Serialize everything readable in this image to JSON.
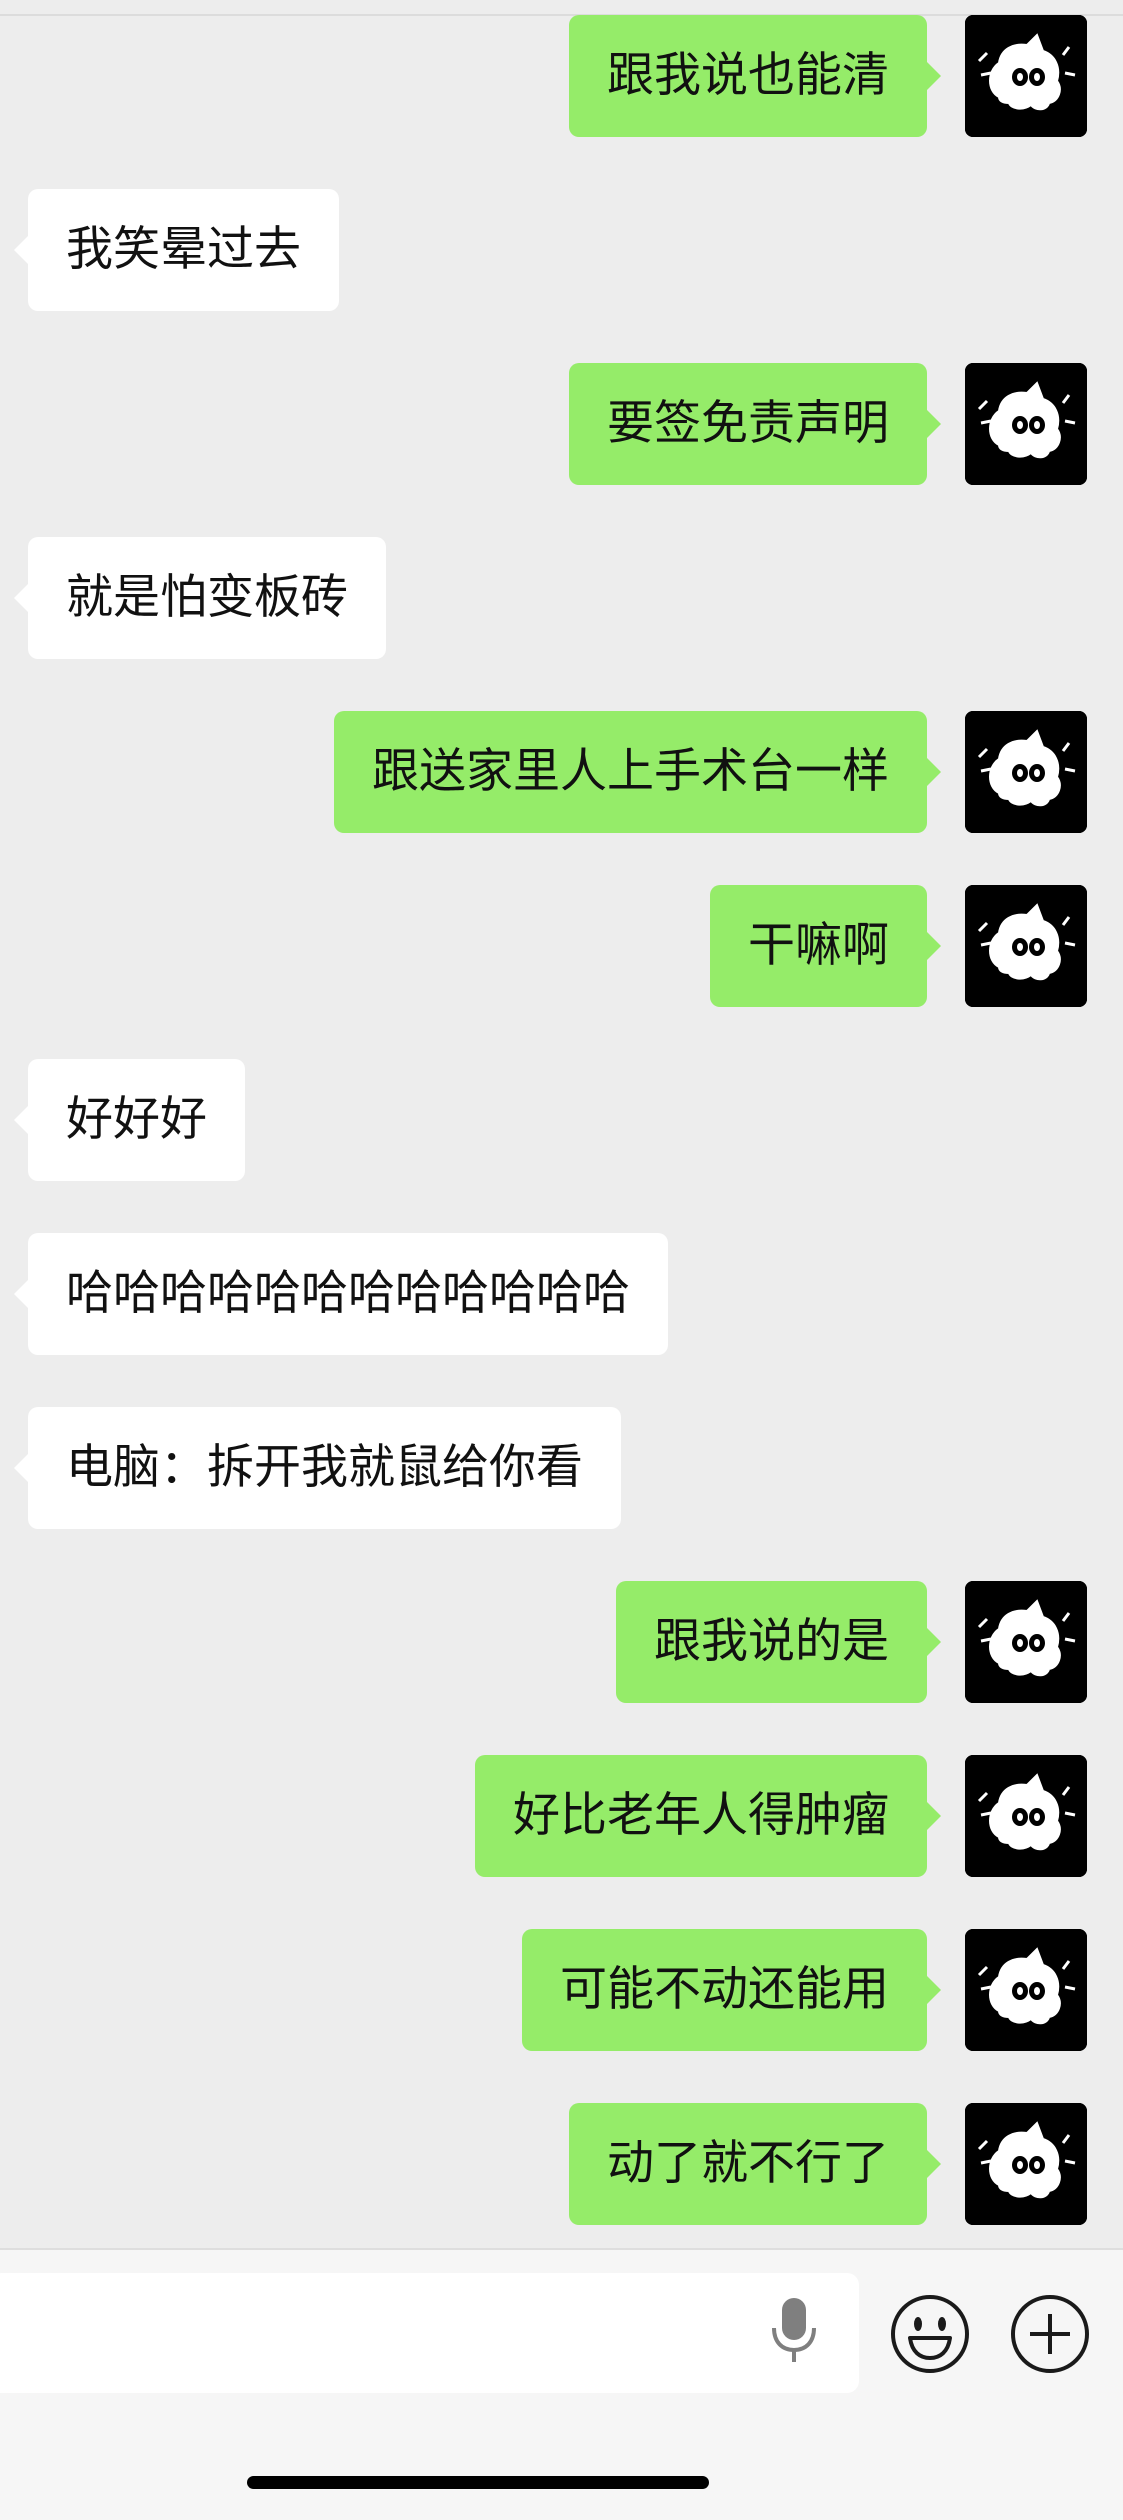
{
  "messages": [
    {
      "side": "outgoing",
      "text": "跟我说也能清"
    },
    {
      "side": "incoming",
      "text": "我笑晕过去"
    },
    {
      "side": "outgoing",
      "text": "要签免责声明"
    },
    {
      "side": "incoming",
      "text": "就是怕变板砖"
    },
    {
      "side": "outgoing",
      "text": "跟送家里人上手术台一样"
    },
    {
      "side": "outgoing",
      "text": "干嘛啊"
    },
    {
      "side": "incoming",
      "text": "好好好"
    },
    {
      "side": "incoming",
      "text": "哈哈哈哈哈哈哈哈哈哈哈哈"
    },
    {
      "side": "incoming",
      "text": "电脑：拆开我就鼠给你看"
    },
    {
      "side": "outgoing",
      "text": "跟我说的是"
    },
    {
      "side": "outgoing",
      "text": "好比老年人得肿瘤"
    },
    {
      "side": "outgoing",
      "text": "可能不动还能用"
    },
    {
      "side": "outgoing",
      "text": "动了就不行了"
    }
  ],
  "input_bar": {
    "text_value": "",
    "voice_icon": "microphone-icon",
    "emoji_icon": "emoji-face-icon",
    "more_icon": "plus-circle-icon"
  },
  "colors": {
    "background": "#ededed",
    "outgoing_bubble": "#95ec69",
    "incoming_bubble": "#ffffff",
    "avatar_background": "#000000"
  }
}
